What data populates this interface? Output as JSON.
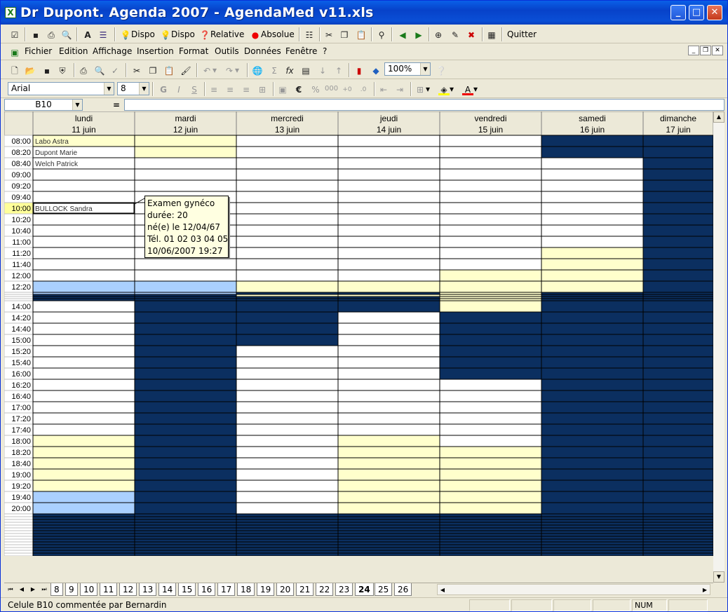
{
  "window": {
    "title": "Dr Dupont. Agenda 2007 - AgendaMed v11.xls",
    "icon": "excel-icon"
  },
  "custom_toolbar": {
    "items": [
      {
        "label": "Dispo",
        "icon": "bulb-off-icon"
      },
      {
        "label": "Dispo",
        "icon": "bulb-on-icon"
      },
      {
        "label": "Relative",
        "icon": "help-question-icon"
      },
      {
        "label": "Absolue",
        "icon": "red-bulb-icon"
      },
      {
        "label": "Quitter",
        "icon": ""
      }
    ]
  },
  "menubar": {
    "items": [
      "Fichier",
      "Edition",
      "Affichage",
      "Insertion",
      "Format",
      "Outils",
      "Données",
      "Fenêtre",
      "?"
    ]
  },
  "standard_toolbar": {
    "zoom": "100%"
  },
  "format_toolbar": {
    "font": "Arial",
    "size": "8"
  },
  "formula_bar": {
    "name_box": "B10",
    "equals": "="
  },
  "calendar": {
    "days": [
      {
        "name": "lundi",
        "date": "11 juin"
      },
      {
        "name": "mardi",
        "date": "12 juin"
      },
      {
        "name": "mercredi",
        "date": "13 juin"
      },
      {
        "name": "jeudi",
        "date": "14 juin"
      },
      {
        "name": "vendredi",
        "date": "15 juin"
      },
      {
        "name": "samedi",
        "date": "16 juin"
      },
      {
        "name": "dimanche",
        "date": "17 juin"
      }
    ],
    "times_morning": [
      "08:00",
      "08:20",
      "08:40",
      "09:00",
      "09:20",
      "09:40",
      "10:00",
      "10:20",
      "10:40",
      "11:00",
      "11:20",
      "11:40",
      "12:00",
      "12:20"
    ],
    "times_afternoon": [
      "14:00",
      "14:20",
      "14:40",
      "15:00",
      "15:20",
      "15:40",
      "16:00",
      "16:20",
      "16:40",
      "17:00",
      "17:20",
      "17:40",
      "18:00",
      "18:20",
      "18:40",
      "19:00",
      "19:20",
      "19:40",
      "20:00"
    ],
    "selected_time": "10:00",
    "appointments": [
      {
        "day": 0,
        "time": "08:00",
        "text": "Labo Astra"
      },
      {
        "day": 0,
        "time": "08:20",
        "text": "Dupont Marie"
      },
      {
        "day": 0,
        "time": "08:40",
        "text": "Welch Patrick"
      },
      {
        "day": 0,
        "time": "10:00",
        "text": "BULLOCK Sandra"
      }
    ],
    "colors": {
      "blocked": "#0b2f60",
      "yellow": "#ffffcc",
      "blue": "#aad0ff",
      "white": "#ffffff",
      "header": "#ece9d8",
      "selected_time_bg": "#ffff99"
    }
  },
  "comment": {
    "lines": [
      "Examen gynéco",
      "durée: 20",
      "né(e) le 12/04/67",
      "Tél. 01 02 03 04 05",
      "10/06/2007 19:27"
    ]
  },
  "sheet_tabs": {
    "tabs": [
      "8",
      "9",
      "10",
      "11",
      "12",
      "13",
      "14",
      "15",
      "16",
      "17",
      "18",
      "19",
      "20",
      "21",
      "22",
      "23",
      "24",
      "25",
      "26"
    ],
    "active": "24"
  },
  "statusbar": {
    "text": "Celule B10 commentée par Bernardin",
    "num": "NUM"
  }
}
